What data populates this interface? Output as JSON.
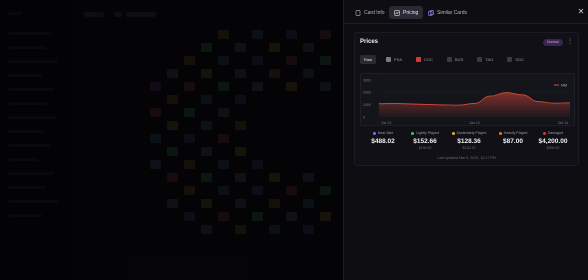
{
  "drawer": {
    "tabs": [
      {
        "label": "Card Info",
        "icon": "card-icon"
      },
      {
        "label": "Pricing",
        "icon": "pricing-icon",
        "active": true
      },
      {
        "label": "Similar Cards",
        "icon": "similar-cards-icon"
      }
    ],
    "close_icon": "close-icon"
  },
  "prices": {
    "title": "Prices",
    "badge": "Normal",
    "chips": [
      {
        "label": "Raw",
        "active": true,
        "color": ""
      },
      {
        "label": "PSA",
        "active": false,
        "color": "#7a7a86"
      },
      {
        "label": "CGC",
        "active": false,
        "color": "#d33a3a"
      },
      {
        "label": "BGS",
        "active": false,
        "color": "#7a7a86"
      },
      {
        "label": "TAG",
        "active": false,
        "color": "#7a7a86"
      },
      {
        "label": "SGC",
        "active": false,
        "color": "#7a7a86"
      }
    ],
    "stats": [
      {
        "label": "Near Mint",
        "color": "#7c6cff",
        "value": "$488.02",
        "sub": ""
      },
      {
        "label": "Lightly Played",
        "color": "#46c46a",
        "value": "$152.66",
        "sub": "$190.00"
      },
      {
        "label": "Moderately Played",
        "color": "#e0b030",
        "value": "$128.36",
        "sub": "$130.13"
      },
      {
        "label": "Heavily Played",
        "color": "#e07a30",
        "value": "$87.00",
        "sub": ""
      },
      {
        "label": "Damaged",
        "color": "#d33a3a",
        "value": "$4,200.00",
        "sub": "$900.00"
      }
    ],
    "updated": "Last updated Mar 9, 2025, 10:17 PM"
  },
  "chart_data": {
    "type": "area",
    "series": [
      {
        "name": "NM",
        "values": [
          1080,
          1100,
          1060,
          1020,
          980,
          960,
          1100,
          1700,
          1980,
          1800,
          1250,
          1120,
          1150
        ]
      }
    ],
    "x_ticks": [
      "Oct 13",
      "Jan 13",
      "Oct 14"
    ],
    "y_ticks": [
      "3000",
      "2000",
      "1000",
      "0"
    ],
    "ylim": [
      0,
      3000
    ],
    "color": "#d84a3a"
  }
}
